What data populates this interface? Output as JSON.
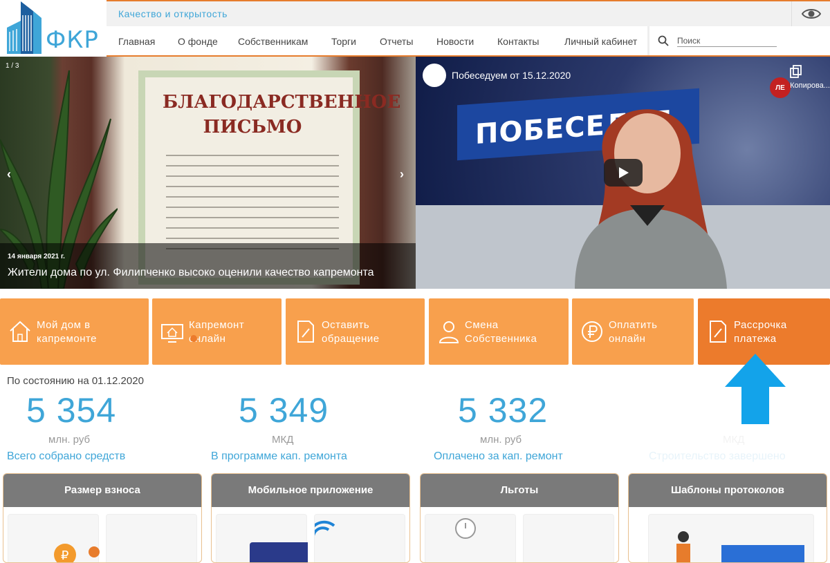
{
  "header": {
    "logo_text": "ФКР",
    "topbar_title": "Качество и открытость",
    "nav": [
      "Главная",
      "О фонде",
      "Собственникам",
      "Торги",
      "Отчеты",
      "Новости",
      "Контакты",
      "Личный кабинет"
    ],
    "search_placeholder": "Поиск"
  },
  "slider": {
    "counter": "1 / 3",
    "letter_title": "БЛАГОДАРСТВЕННОЕ ПИСЬМО",
    "date": "14 января 2021 г.",
    "caption": "Жители дома по ул. Филипченко высоко оценили качество капремонта"
  },
  "video": {
    "title": "Побеседуем от 15.12.2020",
    "studio_text": "ПОБЕСЕДУЕ",
    "copy_label": "Копирова...",
    "tv_logo": "ЛЕ"
  },
  "tiles": [
    {
      "label_1": "Мой дом в",
      "label_2": "капремонте"
    },
    {
      "label_1": "Капремонт",
      "label_2": "онлайн"
    },
    {
      "label_1": "Оставить",
      "label_2": "обращение"
    },
    {
      "label_1": "Смена",
      "label_2": "Собственника"
    },
    {
      "label_1": "Оплатить",
      "label_2": "онлайн"
    },
    {
      "label_1": "Рассрочка",
      "label_2": "платежа"
    }
  ],
  "stats": {
    "as_of": "По состоянию на 01.12.2020",
    "items": [
      {
        "value": "5 354",
        "unit": "млн. руб",
        "label": "Всего собрано средств"
      },
      {
        "value": "5 349",
        "unit": "МКД",
        "label": "В программе кап. ремонта"
      },
      {
        "value": "5 332",
        "unit": "млн. руб",
        "label": "Оплачено за кап. ремонт"
      },
      {
        "value": "",
        "unit": "МКД",
        "label": "Строительство завершено"
      }
    ]
  },
  "cards": [
    {
      "title": "Размер взноса"
    },
    {
      "title": "Мобильное приложение"
    },
    {
      "title": "Льготы"
    },
    {
      "title": "Шаблоны протоколов"
    }
  ],
  "colors": {
    "accent_orange": "#f8a04d",
    "dark_orange": "#ec7b2c",
    "brand_blue": "#3fa6d8",
    "arrow_blue": "#13a3ea"
  }
}
